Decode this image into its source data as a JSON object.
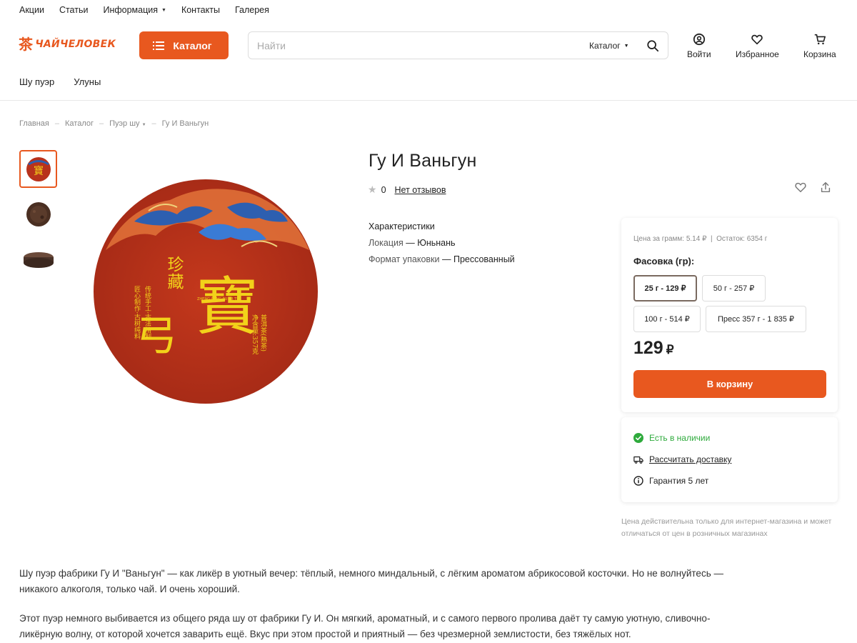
{
  "topnav": {
    "items": [
      "Акции",
      "Статьи",
      "Информация",
      "Контакты",
      "Галерея"
    ]
  },
  "brand": {
    "logo_glyph": "茶",
    "logo_text": "ЧАЙЧЕЛОВЕК",
    "accent_color": "#e8581f"
  },
  "header": {
    "catalog_label": "Каталог",
    "search_placeholder": "Найти",
    "search_scope": "Каталог",
    "login_label": "Войти",
    "favorites_label": "Избранное",
    "cart_label": "Корзина"
  },
  "subnav": {
    "items": [
      "Шу пуэр",
      "Улуны"
    ]
  },
  "breadcrumb": [
    "Главная",
    "Каталог",
    "Пуэр шу",
    "Гу И Ваньгун"
  ],
  "product": {
    "title": "Гу И Ваньгун",
    "rating": "0",
    "reviews_label": "Нет отзывов",
    "specs_title": "Характеристики",
    "specs": [
      {
        "key": "Локация",
        "sep": " — ",
        "value": "Юньнань"
      },
      {
        "key": "Формат упаковки",
        "sep": " — ",
        "value": "Прессованный"
      }
    ],
    "image_text": {
      "label_top": "珍藏",
      "brand_big": "寶",
      "side_left": "传统手工·古法精制",
      "side_left2": "匠心制作·古树纯料",
      "side_right": "普洱茶(熟茶)",
      "side_right2": "净含量:357克",
      "sub_en": "ZHENG CANG PU ER TEA"
    }
  },
  "buy": {
    "price_per_gram": "Цена за грамм: 5.14 ₽",
    "stock": "Остаток: 6354 г",
    "pack_label": "Фасовка (гр):",
    "options": [
      "25 г - 129 ₽",
      "50 г - 257 ₽",
      "100 г - 514 ₽",
      "Пресс 357 г - 1 835 ₽"
    ],
    "selected_option": 0,
    "price": "129",
    "currency": "₽",
    "cart_button": "В корзину"
  },
  "info": {
    "availability": "Есть в наличии",
    "delivery": "Рассчитать доставку",
    "warranty": "Гарантия 5 лет",
    "availability_color": "#2eaa3c"
  },
  "note": "Цена действительна только для интернет-магазина и может отличаться от цен в розничных магазинах",
  "description": [
    "Шу пуэр фабрики Гу И \"Ваньгун\"  — как ликёр в уютный вечер: тёплый, немного миндальный, с лёгким ароматом абрикосовой косточки. Но не волнуйтесь — никакого алкоголя, только чай. И очень хороший.",
    "Этот пуэр немного выбивается из общего ряда шу от фабрики Гу И. Он мягкий, ароматный, и с самого первого пролива даёт ту самую уютную, сливочно-ликёрную волну, от которой хочется заварить ещё. Вкус при этом простой и приятный — без чрезмерной землистости, без тяжёлых нот."
  ]
}
